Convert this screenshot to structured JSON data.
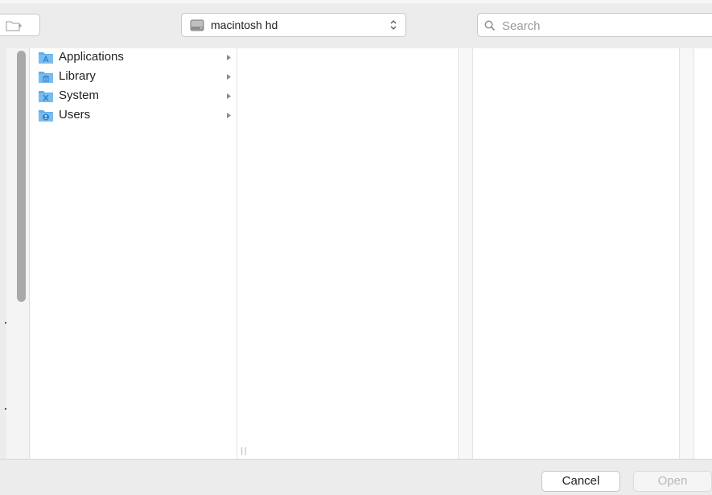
{
  "toolbar": {
    "location_label": "macintosh hd",
    "search_placeholder": "Search"
  },
  "column1": {
    "items": [
      {
        "label": "Applications",
        "icon": "applications-folder-icon"
      },
      {
        "label": "Library",
        "icon": "library-folder-icon"
      },
      {
        "label": "System",
        "icon": "system-folder-icon"
      },
      {
        "label": "Users",
        "icon": "users-folder-icon"
      }
    ]
  },
  "footer": {
    "cancel_label": "Cancel",
    "open_label": "Open"
  },
  "colors": {
    "folder_blue": "#62aee8",
    "folder_dark": "#3b8fd6",
    "window_bg": "#ececec",
    "disabled_text": "#b9b9b9"
  }
}
